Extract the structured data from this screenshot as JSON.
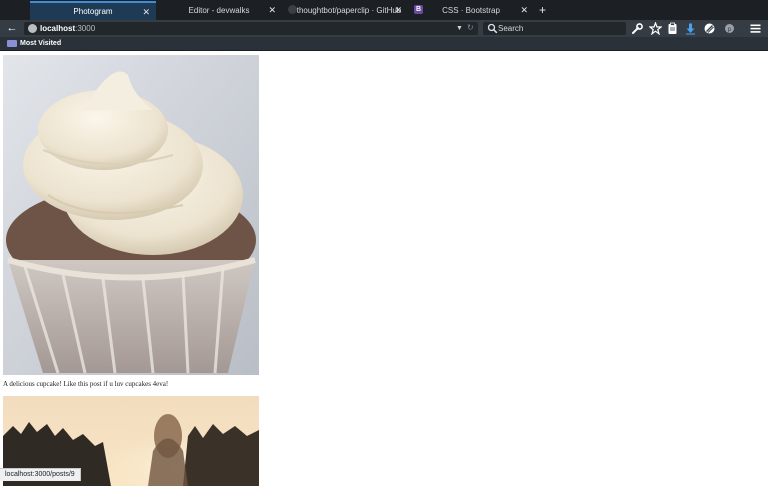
{
  "tabs": [
    {
      "label": "Photogram",
      "active": true
    },
    {
      "label": "Editor - devwalks",
      "active": false
    },
    {
      "label": "thoughtbot/paperclip · GitHub",
      "active": false
    },
    {
      "label": "CSS · Bootstrap",
      "active": false,
      "favicon_text": "B"
    }
  ],
  "tab_close_glyph": "✕",
  "new_tab_glyph": "+",
  "nav": {
    "back_glyph": "←",
    "url_host": "localhost",
    "url_port": ":3000",
    "reload_glyph": "↻",
    "dropdown_glyph": "▼",
    "search_placeholder": "Search"
  },
  "bookmarks": {
    "label": "Most Visited"
  },
  "feed": {
    "caption": "A delicious cupcake! Like this post if u luv cupcakes 4eva!"
  },
  "status_url": "localhost:3000/posts/9",
  "colors": {
    "tabbar": "#1c2024",
    "active_tab": "#1f3a55",
    "navbar": "#353c44",
    "accent": "#3c8ed6"
  },
  "icons": [
    "globe-icon",
    "search-icon",
    "wrench-icon",
    "star-icon",
    "clipboard-icon",
    "download-icon",
    "pocket-icon",
    "profile-icon",
    "menu-icon",
    "folder-icon"
  ]
}
